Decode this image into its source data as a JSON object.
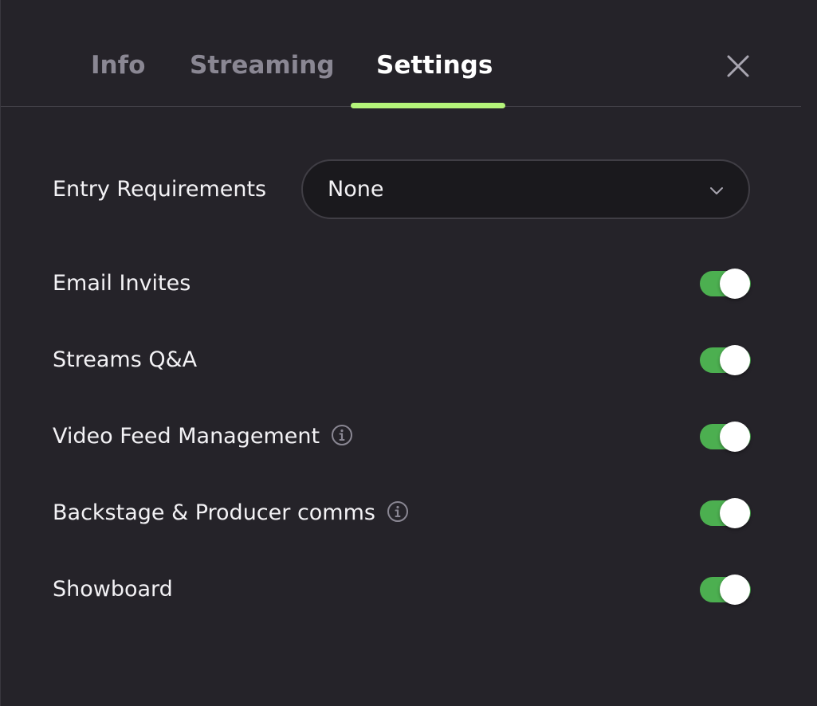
{
  "tabs": [
    {
      "label": "Info",
      "active": false
    },
    {
      "label": "Streaming",
      "active": false
    },
    {
      "label": "Settings",
      "active": true
    }
  ],
  "entry_requirements": {
    "label": "Entry Requirements",
    "value": "None"
  },
  "settings": [
    {
      "label": "Email Invites",
      "enabled": true,
      "info": false
    },
    {
      "label": "Streams Q&A",
      "enabled": true,
      "info": false
    },
    {
      "label": "Video Feed Management",
      "enabled": true,
      "info": true
    },
    {
      "label": "Backstage & Producer comms",
      "enabled": true,
      "info": true
    },
    {
      "label": "Showboard",
      "enabled": true,
      "info": false
    }
  ],
  "icons": {
    "close": "close-icon",
    "chevron": "chevron-down-icon",
    "info": "info-icon"
  },
  "colors": {
    "background": "#252329",
    "accent": "#b5f57a",
    "toggle_on": "#4caf50",
    "text": "#f3f2f5",
    "muted": "#8a8793"
  }
}
